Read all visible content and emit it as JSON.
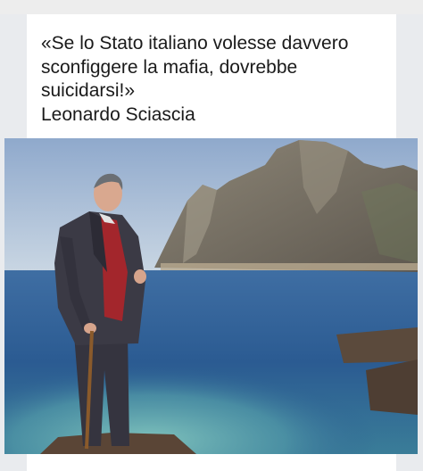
{
  "post": {
    "quote": "«Se lo Stato italiano volesse davvero\nsconfiggere la mafia, dovrebbe\nsuicidarsi!»\nLeonardo Sciascia"
  },
  "photo": {
    "description_icon": "photo-icon",
    "colors": {
      "sky": "#9fb6d4",
      "sea": "#2f5f96",
      "shallow_water": "#63a6ae",
      "mountain": "#7d7566",
      "jacket": "#3b3a45",
      "sweater": "#a3262c"
    }
  }
}
